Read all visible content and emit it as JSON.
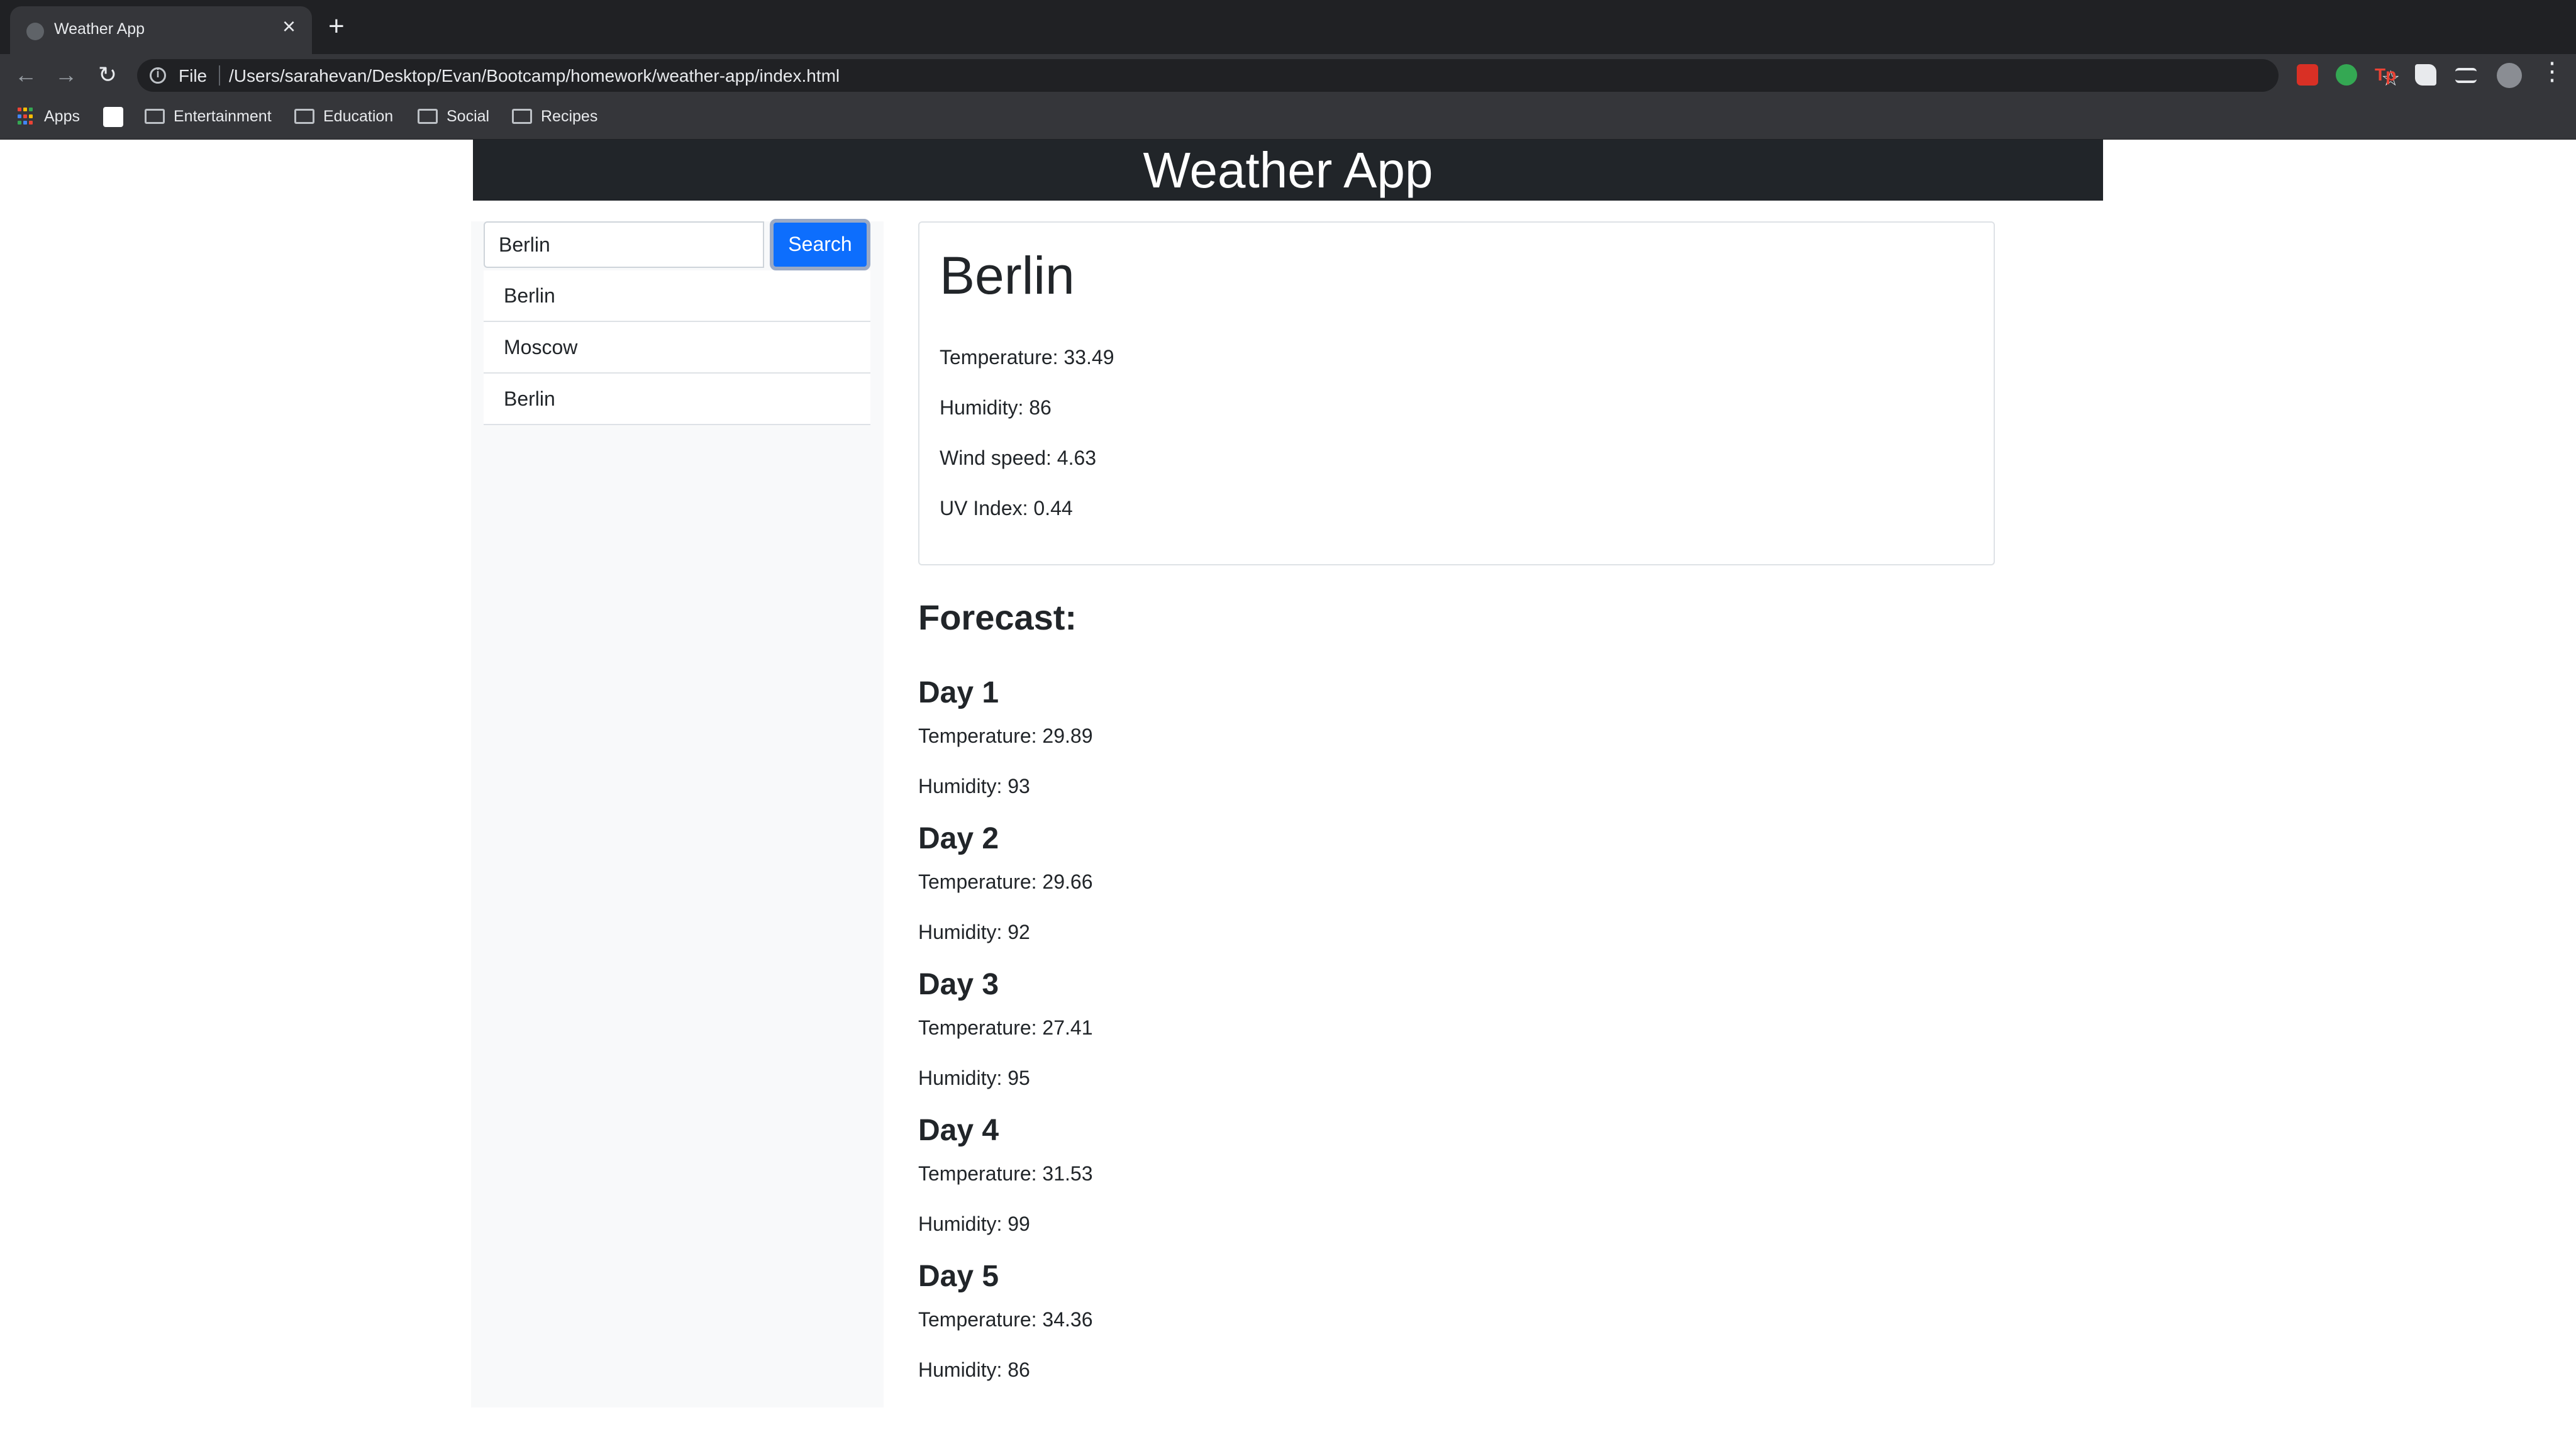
{
  "browser": {
    "tab_title": "Weather App",
    "new_tab_glyph": "+",
    "close_glyph": "×",
    "back_glyph": "←",
    "forward_glyph": "→",
    "reload_glyph": "↻",
    "scheme": "File",
    "url": "/Users/sarahevan/Desktop/Evan/Bootcamp/homework/weather-app/index.html",
    "star_glyph": "☆",
    "menu_glyph": "⋮",
    "bookmarks": {
      "apps": "Apps",
      "entertainment": "Entertainment",
      "education": "Education",
      "social": "Social",
      "recipes": "Recipes"
    }
  },
  "app": {
    "title": "Weather App",
    "search": {
      "value": "Berlin",
      "button_label": "Search"
    },
    "history": [
      "Berlin",
      "Moscow",
      "Berlin"
    ],
    "current": {
      "city": "Berlin",
      "temperature": "Temperature: 33.49",
      "humidity": "Humidity: 86",
      "wind": "Wind speed: 4.63",
      "uv": "UV Index: 0.44"
    },
    "forecast_title": "Forecast:",
    "forecast": [
      {
        "day": "Day 1",
        "temperature": "Temperature: 29.89",
        "humidity": "Humidity: 93"
      },
      {
        "day": "Day 2",
        "temperature": "Temperature: 29.66",
        "humidity": "Humidity: 92"
      },
      {
        "day": "Day 3",
        "temperature": "Temperature: 27.41",
        "humidity": "Humidity: 95"
      },
      {
        "day": "Day 4",
        "temperature": "Temperature: 31.53",
        "humidity": "Humidity: 99"
      },
      {
        "day": "Day 5",
        "temperature": "Temperature: 34.36",
        "humidity": "Humidity: 86"
      }
    ]
  },
  "colors": {
    "header_bg": "#212529",
    "button": "#0d6efd",
    "sidebar_bg": "#f8f9fa"
  }
}
